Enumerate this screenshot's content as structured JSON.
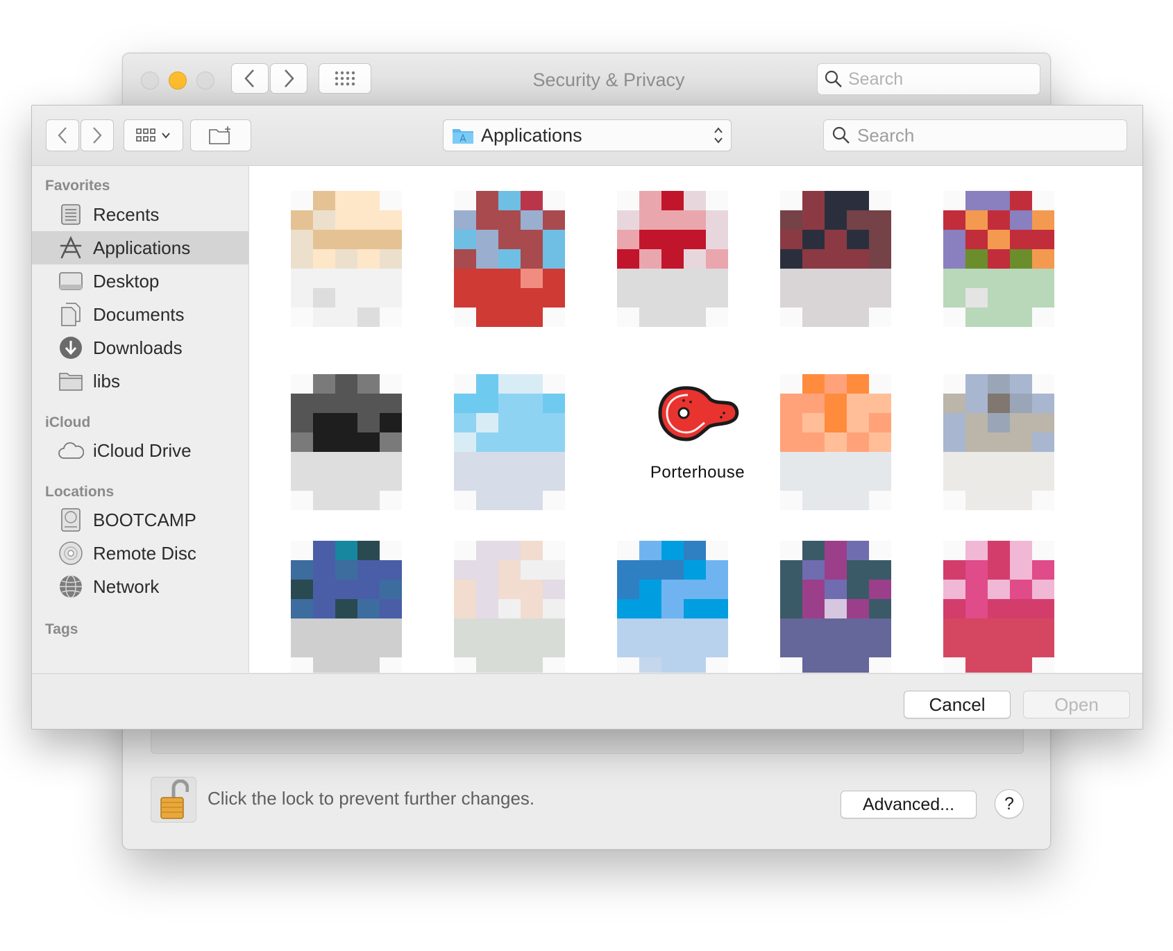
{
  "background_window": {
    "title": "Security & Privacy",
    "search_placeholder": "Search",
    "lock_message": "Click the lock to prevent further changes.",
    "advanced_label": "Advanced...",
    "help_label": "?"
  },
  "dialog": {
    "location": "Applications",
    "search_placeholder": "Search",
    "sidebar": {
      "favorites_header": "Favorites",
      "favorites": [
        {
          "label": "Recents",
          "icon": "recents-icon"
        },
        {
          "label": "Applications",
          "icon": "applications-icon",
          "selected": true
        },
        {
          "label": "Desktop",
          "icon": "desktop-icon"
        },
        {
          "label": "Documents",
          "icon": "documents-icon"
        },
        {
          "label": "Downloads",
          "icon": "downloads-icon"
        },
        {
          "label": "libs",
          "icon": "folder-icon"
        }
      ],
      "icloud_header": "iCloud",
      "icloud": [
        {
          "label": "iCloud Drive",
          "icon": "cloud-icon"
        }
      ],
      "locations_header": "Locations",
      "locations": [
        {
          "label": "BOOTCAMP",
          "icon": "disk-icon"
        },
        {
          "label": "Remote Disc",
          "icon": "disc-icon"
        },
        {
          "label": "Network",
          "icon": "network-icon"
        }
      ],
      "tags_header": "Tags"
    },
    "apps": [
      {
        "label": "Porterhouse",
        "icon": "steak-icon",
        "visible": true
      }
    ],
    "cancel_label": "Cancel",
    "open_label": "Open"
  },
  "colors": {
    "selection": "#d4d4d4",
    "steak_red": "#e8332f",
    "lock_gold": "#e9a83a",
    "minimize_yellow": "#fdbd2e"
  }
}
